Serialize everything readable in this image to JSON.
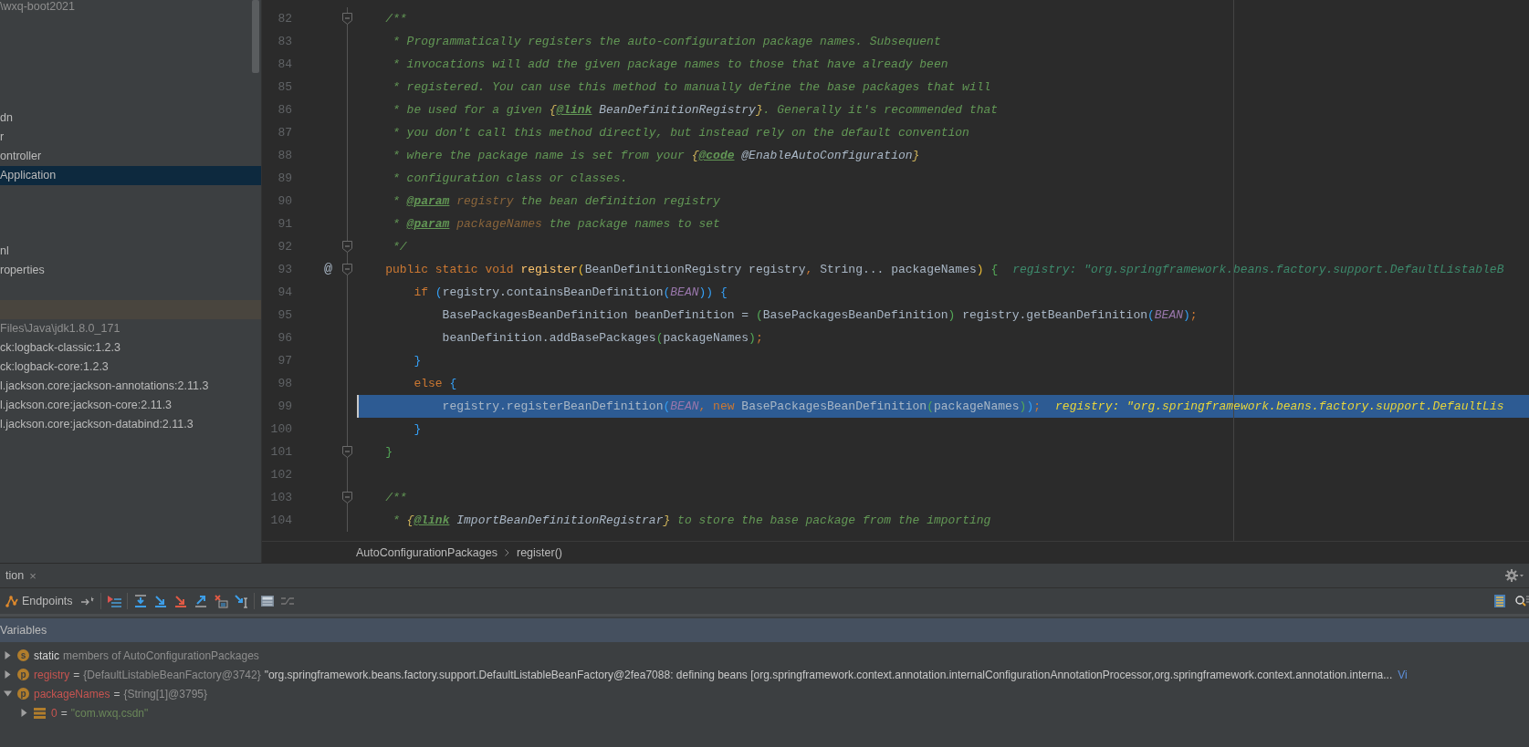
{
  "sidebar": {
    "sections": [
      [
        {
          "label": "\\wxq-boot2021",
          "selected": false,
          "dimmed": true
        }
      ],
      [
        {
          "label": "dn",
          "selected": false,
          "dimmed": false
        },
        {
          "label": "r",
          "selected": false,
          "dimmed": false
        },
        {
          "label": "ontroller",
          "selected": false,
          "dimmed": false
        },
        {
          "label": "Application",
          "selected": true,
          "dimmed": false
        }
      ],
      [
        {
          "label": "nl",
          "selected": false,
          "dimmed": false
        },
        {
          "label": "roperties",
          "selected": false,
          "dimmed": false
        }
      ],
      [
        {
          "label": "Files\\Java\\jdk1.8.0_171",
          "selected": false,
          "dimmed": true
        },
        {
          "label": "ck:logback-classic:1.2.3",
          "selected": false,
          "dimmed": false
        },
        {
          "label": "ck:logback-core:1.2.3",
          "selected": false,
          "dimmed": false
        },
        {
          "label": "l.jackson.core:jackson-annotations:2.11.3",
          "selected": false,
          "dimmed": false
        },
        {
          "label": "l.jackson.core:jackson-core:2.11.3",
          "selected": false,
          "dimmed": false
        },
        {
          "label": "l.jackson.core:jackson-databind:2.11.3",
          "selected": false,
          "dimmed": false
        }
      ]
    ]
  },
  "editor": {
    "lines": [
      {
        "number": "82",
        "fold_marker": true,
        "current": false,
        "tokens": [
          {
            "kind": "c",
            "text": "    /**"
          }
        ]
      },
      {
        "number": "83",
        "fold_marker": false,
        "current": false,
        "tokens": [
          {
            "kind": "c",
            "text": "     * Programmatically registers the auto-configuration package names. Subsequent"
          }
        ]
      },
      {
        "number": "84",
        "fold_marker": false,
        "current": false,
        "tokens": [
          {
            "kind": "c",
            "text": "     * invocations will add the given package names to those that have already been"
          }
        ]
      },
      {
        "number": "85",
        "fold_marker": false,
        "current": false,
        "tokens": [
          {
            "kind": "c",
            "text": "     * registered. You can use this method to manually define the base packages that will"
          }
        ]
      },
      {
        "number": "86",
        "fold_marker": false,
        "current": false,
        "tokens": [
          {
            "kind": "c",
            "text": "     * be used for a given "
          },
          {
            "kind": "db",
            "text": "{"
          },
          {
            "kind": "dt",
            "text": "@link"
          },
          {
            "kind": "dr",
            "text": " BeanDefinitionRegistry"
          },
          {
            "kind": "db",
            "text": "}"
          },
          {
            "kind": "c",
            "text": ". Generally it's recommended that"
          }
        ]
      },
      {
        "number": "87",
        "fold_marker": false,
        "current": false,
        "tokens": [
          {
            "kind": "c",
            "text": "     * you don't call this method directly, but instead rely on the default convention"
          }
        ]
      },
      {
        "number": "88",
        "fold_marker": false,
        "current": false,
        "tokens": [
          {
            "kind": "c",
            "text": "     * where the package name is set from your "
          },
          {
            "kind": "db",
            "text": "{"
          },
          {
            "kind": "dt",
            "text": "@code"
          },
          {
            "kind": "dr",
            "text": " @EnableAutoConfiguration"
          },
          {
            "kind": "db",
            "text": "}"
          }
        ]
      },
      {
        "number": "89",
        "fold_marker": false,
        "current": false,
        "tokens": [
          {
            "kind": "c",
            "text": "     * configuration class or classes."
          }
        ]
      },
      {
        "number": "90",
        "fold_marker": false,
        "current": false,
        "tokens": [
          {
            "kind": "c",
            "text": "     * "
          },
          {
            "kind": "dt",
            "text": "@param"
          },
          {
            "kind": "dp",
            "text": " registry"
          },
          {
            "kind": "c",
            "text": " the bean definition registry"
          }
        ]
      },
      {
        "number": "91",
        "fold_marker": false,
        "current": false,
        "tokens": [
          {
            "kind": "c",
            "text": "     * "
          },
          {
            "kind": "dt",
            "text": "@param"
          },
          {
            "kind": "dp",
            "text": " packageNames"
          },
          {
            "kind": "c",
            "text": " the package names to set"
          }
        ]
      },
      {
        "number": "92",
        "fold_marker": true,
        "current": false,
        "tokens": [
          {
            "kind": "c",
            "text": "     */"
          }
        ]
      },
      {
        "number": "93",
        "fold_marker": true,
        "current": false,
        "gutter": "@",
        "tokens": [
          {
            "kind": "k",
            "text": "    public static void "
          },
          {
            "kind": "m",
            "text": "register"
          },
          {
            "kind": "y1",
            "text": "("
          },
          {
            "kind": "p",
            "text": "BeanDefinitionRegistry registry"
          },
          {
            "kind": "o",
            "text": ","
          },
          {
            "kind": "p",
            "text": " String... packageNames"
          },
          {
            "kind": "y1",
            "text": ")"
          },
          {
            "kind": "g2",
            "text": " {"
          }
        ],
        "hint": "registry: \"org.springframework.beans.factory.support.DefaultListableB"
      },
      {
        "number": "94",
        "fold_marker": false,
        "current": false,
        "tokens": [
          {
            "kind": "k",
            "text": "        if "
          },
          {
            "kind": "b3",
            "text": "("
          },
          {
            "kind": "p",
            "text": "registry.containsBeanDefinition"
          },
          {
            "kind": "b3",
            "text": "("
          },
          {
            "kind": "f",
            "text": "BEAN"
          },
          {
            "kind": "b3",
            "text": ")) {"
          }
        ]
      },
      {
        "number": "95",
        "fold_marker": false,
        "current": false,
        "tokens": [
          {
            "kind": "p",
            "text": "            BasePackagesBeanDefinition beanDefinition = "
          },
          {
            "kind": "g2",
            "text": "("
          },
          {
            "kind": "p",
            "text": "BasePackagesBeanDefinition"
          },
          {
            "kind": "g2",
            "text": ")"
          },
          {
            "kind": "p",
            "text": " registry.getBeanDefinition"
          },
          {
            "kind": "b3",
            "text": "("
          },
          {
            "kind": "f",
            "text": "BEAN"
          },
          {
            "kind": "b3",
            "text": ")"
          },
          {
            "kind": "o",
            "text": ";"
          }
        ]
      },
      {
        "number": "96",
        "fold_marker": false,
        "current": false,
        "tokens": [
          {
            "kind": "p",
            "text": "            beanDefinition.addBasePackages"
          },
          {
            "kind": "g2",
            "text": "("
          },
          {
            "kind": "p",
            "text": "packageNames"
          },
          {
            "kind": "g2",
            "text": ")"
          },
          {
            "kind": "o",
            "text": ";"
          }
        ]
      },
      {
        "number": "97",
        "fold_marker": false,
        "current": false,
        "tokens": [
          {
            "kind": "b3",
            "text": "        }"
          }
        ]
      },
      {
        "number": "98",
        "fold_marker": false,
        "current": false,
        "tokens": [
          {
            "kind": "k",
            "text": "        else "
          },
          {
            "kind": "b3",
            "text": "{"
          }
        ]
      },
      {
        "number": "99",
        "fold_marker": false,
        "current": true,
        "tokens": [
          {
            "kind": "p",
            "text": "            registry.registerBeanDefinition"
          },
          {
            "kind": "b3",
            "text": "("
          },
          {
            "kind": "f",
            "text": "BEAN"
          },
          {
            "kind": "o",
            "text": ","
          },
          {
            "kind": "k",
            "text": " new "
          },
          {
            "kind": "p",
            "text": "BasePackagesBeanDefinition"
          },
          {
            "kind": "g2",
            "text": "("
          },
          {
            "kind": "p",
            "text": "packageNames"
          },
          {
            "kind": "g2",
            "text": ")"
          },
          {
            "kind": "b3",
            "text": ")"
          },
          {
            "kind": "o",
            "text": ";"
          }
        ],
        "hint": "registry: \"org.springframework.beans.factory.support.DefaultLis"
      },
      {
        "number": "100",
        "fold_marker": false,
        "current": false,
        "tokens": [
          {
            "kind": "b3",
            "text": "        }"
          }
        ]
      },
      {
        "number": "101",
        "fold_marker": true,
        "current": false,
        "tokens": [
          {
            "kind": "g2",
            "text": "    }"
          }
        ]
      },
      {
        "number": "102",
        "fold_marker": false,
        "current": false
      },
      {
        "number": "103",
        "fold_marker": true,
        "current": false,
        "tokens": [
          {
            "kind": "c",
            "text": "    /**"
          }
        ]
      },
      {
        "number": "104",
        "fold_marker": false,
        "current": false,
        "tokens": [
          {
            "kind": "c",
            "text": "     * "
          },
          {
            "kind": "db",
            "text": "{"
          },
          {
            "kind": "dt",
            "text": "@link"
          },
          {
            "kind": "dr",
            "text": " ImportBeanDefinitionRegistrar"
          },
          {
            "kind": "db",
            "text": "}"
          },
          {
            "kind": "c",
            "text": " to store the base package from the importing"
          }
        ]
      }
    ],
    "breadcrumbs": [
      "AutoConfigurationPackages",
      "register()"
    ]
  },
  "debug": {
    "tab": {
      "label": "tion",
      "close": "×"
    },
    "toolbar": {
      "endpoints": "Endpoints"
    },
    "variables_header": "Variables",
    "variables": [
      {
        "kind": "static",
        "badge": "s",
        "name": "static",
        "value": "members of AutoConfigurationPackages",
        "expanded": false
      },
      {
        "kind": "field",
        "badge": "p",
        "name": "registry",
        "separator": "=",
        "type": "{DefaultListableBeanFactory@3742}",
        "value": "\"org.springframework.beans.factory.support.DefaultListableBeanFactory@2fea7088: defining beans [org.springframework.context.annotation.internalConfigurationAnnotationProcessor,org.springframework.context.annotation.interna...",
        "link": "Vi",
        "expanded": false
      },
      {
        "kind": "field",
        "badge": "p",
        "name": "packageNames",
        "separator": "=",
        "type": "{String[1]@3795}",
        "expanded": true,
        "children": [
          {
            "kind": "element",
            "name": "0",
            "separator": "=",
            "value": "\"com.wxq.csdn\"",
            "expanded": false
          }
        ]
      }
    ]
  }
}
